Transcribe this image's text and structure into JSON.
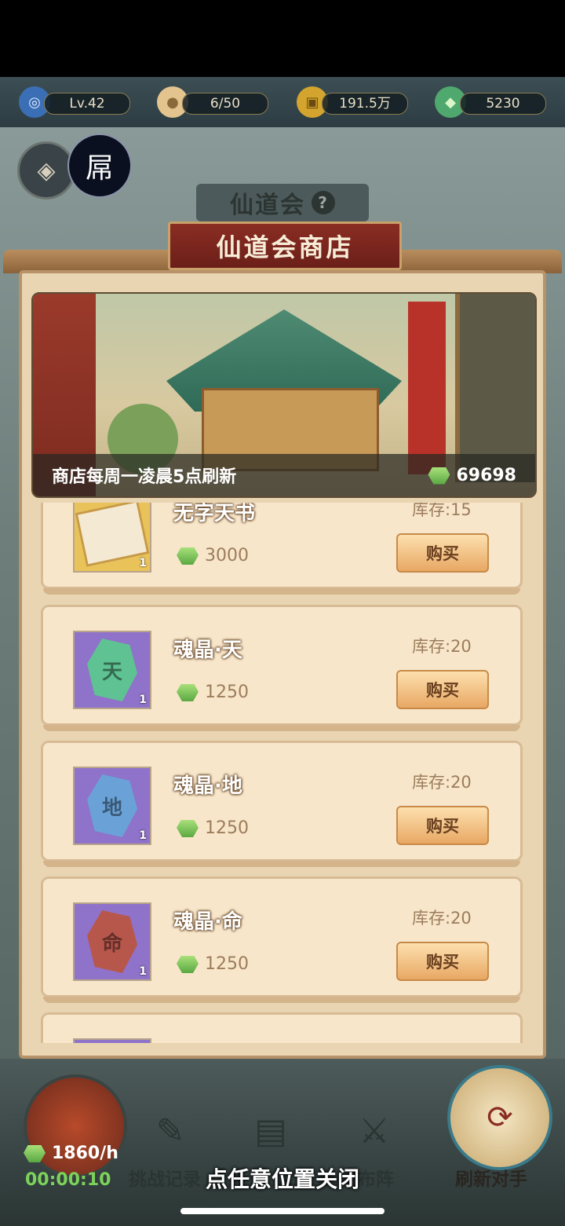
{
  "status_bar": {
    "level": "Lv.42",
    "stamina": "6/50",
    "coins": "191.5万",
    "jade": "5230"
  },
  "header": {
    "avatar_char": "屌",
    "section_title": "仙道会",
    "help_label": "?"
  },
  "shop": {
    "title": "仙道会商店",
    "refresh_notice": "商店每周一凌晨5点刷新",
    "currency_balance": "69698",
    "items": [
      {
        "name": "无字天书",
        "price": "3000",
        "stock": "库存:15",
        "count": "1",
        "buy_label": "购买",
        "icon": "book-icon",
        "bg": "#e9c35a",
        "stone_color": ""
      },
      {
        "name": "魂晶·天",
        "price": "1250",
        "stock": "库存:20",
        "count": "1",
        "buy_label": "购买",
        "icon": "soul-crystal-heaven-icon",
        "bg": "#8f72c9",
        "stone_color": "#5fc293",
        "glyph": "天"
      },
      {
        "name": "魂晶·地",
        "price": "1250",
        "stock": "库存:20",
        "count": "1",
        "buy_label": "购买",
        "icon": "soul-crystal-earth-icon",
        "bg": "#8f72c9",
        "stone_color": "#6aa2d8",
        "glyph": "地"
      },
      {
        "name": "魂晶·命",
        "price": "1250",
        "stock": "库存:20",
        "count": "1",
        "buy_label": "购买",
        "icon": "soul-crystal-fate-icon",
        "bg": "#8f72c9",
        "stone_color": "#b7574b",
        "glyph": "命"
      }
    ]
  },
  "bottom": {
    "rate": "1860/h",
    "timer": "00:00:10",
    "challenge_log": "挑战记录",
    "formation": "布阵",
    "refresh_opponent": "刷新对手",
    "close_hint": "点任意位置关闭"
  },
  "colors": {
    "accent_red": "#8a2d23",
    "panel": "#e9d5b1",
    "gem_green": "#7cd35a"
  }
}
